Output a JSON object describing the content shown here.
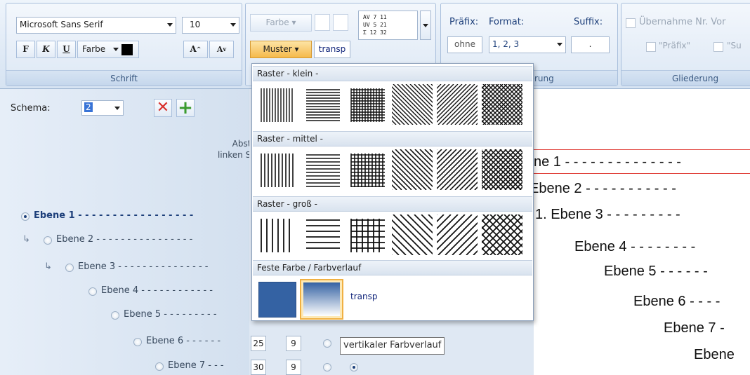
{
  "ribbon": {
    "schrift": {
      "title": "Schrift",
      "font_name": "Microsoft Sans Serif",
      "font_size": "10",
      "bold": "F",
      "italic": "K",
      "underline": "U",
      "color_label": "Farbe",
      "grow_label": "A",
      "shrink_label": "A"
    },
    "fill": {
      "farbe_label": "Farbe",
      "muster_label": "Muster",
      "transp_label": "transp",
      "stats": [
        "AV  7 11",
        "UV  5 21",
        "Σ  12 32"
      ]
    },
    "nummerierung": {
      "title_partial": "fierung",
      "prefix_label": "Präfix:",
      "format_label": "Format:",
      "suffix_label": "Suffix:",
      "prefix_value": "ohne",
      "format_value": "1, 2, 3",
      "suffix_value": "."
    },
    "gliederung": {
      "title": "Gliederung",
      "uebernahme_label": "Übernahme Nr. Vor",
      "praefix_check": "\"Präfix\"",
      "suffix_check": "\"Su"
    }
  },
  "left_panel": {
    "schema_label": "Schema:",
    "schema_value": "2",
    "abstand_line1": "Abstand",
    "abstand_line2": "linken Seite",
    "levels": [
      {
        "label": "Ebene 1",
        "dashes": "- - - - - - - - - - - - - - - - -"
      },
      {
        "label": "Ebene 2",
        "dashes": "- - - - - - - - - - - - - - - -"
      },
      {
        "label": "Ebene 3",
        "dashes": "- - - - - - - - - - - - - - -"
      },
      {
        "label": "Ebene 4",
        "dashes": "- - - - - - - - - - - -"
      },
      {
        "label": "Ebene 5",
        "dashes": "- - - - - - - - -"
      },
      {
        "label": "Ebene 6",
        "dashes": "- - - - - -"
      },
      {
        "label": "Ebene 7",
        "dashes": "- - -"
      }
    ],
    "row6_values": [
      "25",
      "9"
    ],
    "row7_values": [
      "30",
      "9"
    ]
  },
  "dropdown": {
    "sections": [
      "Raster - klein -",
      "Raster - mittel -",
      "Raster - groß -",
      "Feste Farbe / Farbverlauf"
    ],
    "transp_label": "transp",
    "solid_color": "#3462a3"
  },
  "tooltip": "vertikaler Farbverlauf",
  "canvas": {
    "lines": [
      "ne 1 - - - - - - - - - - - - - -",
      "Ebene 2 - - - - - - - - - - -",
      "1. Ebene 3 - - - - - - - - -",
      "Ebene 4 - - - - - - - -",
      "Ebene 5 - - - - - -",
      "Ebene 6 - - - -",
      "Ebene 7 -",
      "Ebene"
    ]
  },
  "colors": {
    "accent_orange": "#f7c66b",
    "delete_red": "#d9302b",
    "add_green": "#3a9b2e",
    "canvas_line_red": "#e0403a"
  }
}
